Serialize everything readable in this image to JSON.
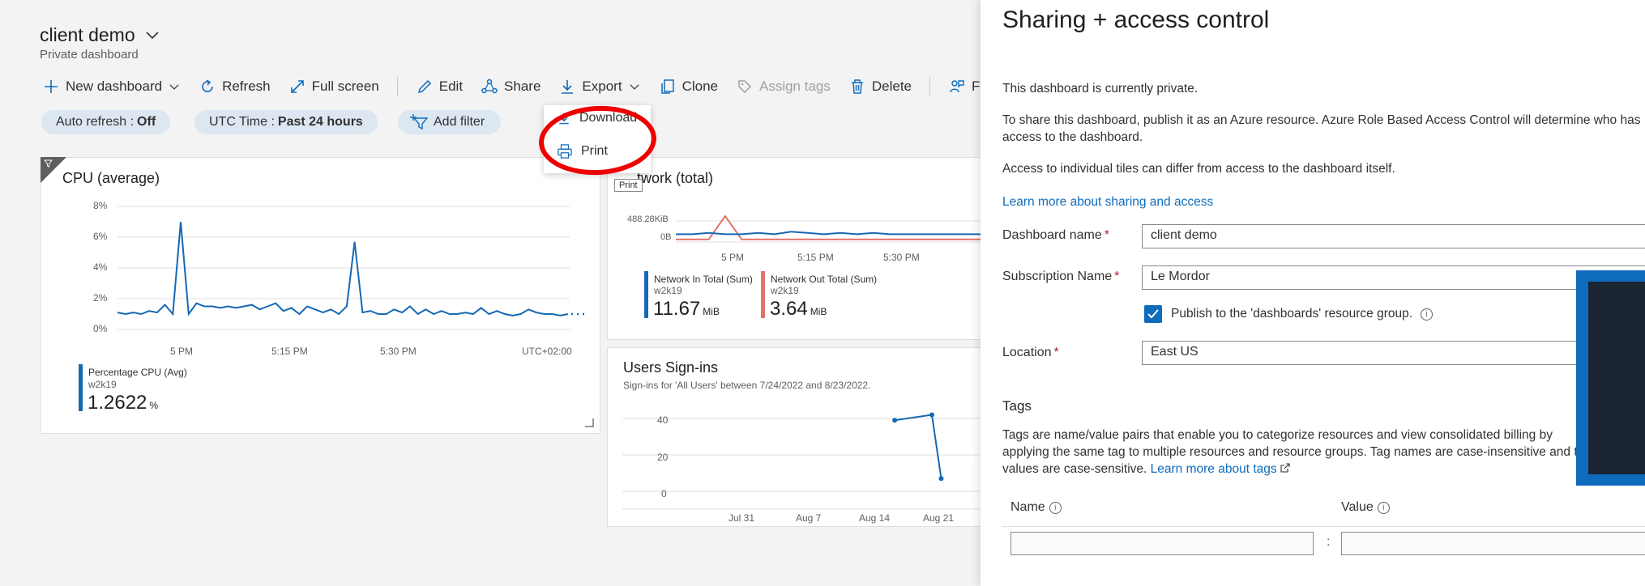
{
  "header": {
    "title": "client demo",
    "subtitle": "Private dashboard"
  },
  "toolbar": {
    "new_dashboard": "New dashboard",
    "refresh": "Refresh",
    "full_screen": "Full screen",
    "edit": "Edit",
    "share": "Share",
    "export": "Export",
    "clone": "Clone",
    "assign_tags": "Assign tags",
    "delete": "Delete",
    "feedback_partial": "Fe"
  },
  "filters": {
    "auto_refresh_label": "Auto refresh :",
    "auto_refresh_value": "Off",
    "time_label": "UTC Time :",
    "time_value": "Past 24 hours",
    "add_filter": "Add filter"
  },
  "export_menu": {
    "download": "Download",
    "print": "Print",
    "tooltip": "Print"
  },
  "cpu_tile": {
    "title": "CPU (average)",
    "y_ticks": [
      "8%",
      "6%",
      "4%",
      "2%",
      "0%"
    ],
    "x_ticks": [
      "5 PM",
      "5:15 PM",
      "5:30 PM",
      "UTC+02:00"
    ],
    "legend_name": "Percentage CPU (Avg)",
    "legend_sub": "w2k19",
    "legend_value": "1.2622",
    "legend_unit": "%"
  },
  "network_tile": {
    "title_partial": "twork (total)",
    "y_ticks": [
      "488.28KiB",
      "0B"
    ],
    "x_ticks": [
      "5 PM",
      "5:15 PM",
      "5:30 PM"
    ],
    "in_name": "Network In Total (Sum)",
    "in_sub": "w2k19",
    "in_value": "11.67",
    "in_unit": "MiB",
    "out_name": "Network Out Total (Sum)",
    "out_sub": "w2k19",
    "out_value": "3.64",
    "out_unit": "MiB"
  },
  "signins_tile": {
    "title": "Users Sign-ins",
    "subtitle": "Sign-ins for 'All Users' between 7/24/2022 and 8/23/2022.",
    "y_ticks": [
      "40",
      "20",
      "0"
    ],
    "x_ticks": [
      "Jul 31",
      "Aug 7",
      "Aug 14",
      "Aug 21"
    ]
  },
  "chart_data": [
    {
      "type": "line",
      "title": "CPU (average)",
      "ylim": [
        0,
        8
      ],
      "y_unit": "%",
      "x_ticks": [
        "5 PM",
        "5:15 PM",
        "5:30 PM"
      ],
      "series": [
        {
          "name": "Percentage CPU (Avg)",
          "values": [
            1.1,
            1.0,
            1.1,
            1.0,
            1.2,
            1.1,
            1.6,
            1.0,
            7.0,
            1.0,
            1.7,
            1.5,
            1.5,
            1.4,
            1.5,
            1.4,
            1.5,
            1.6,
            1.3,
            1.5,
            1.7,
            1.2,
            1.4,
            1.0,
            1.5,
            1.3,
            1.1,
            1.3,
            1.0,
            1.5,
            5.7,
            1.1,
            1.2,
            1.0,
            1.0,
            1.3,
            1.1,
            1.5,
            1.0,
            1.3,
            1.0,
            1.2,
            1.0,
            1.0,
            1.1,
            1.0,
            1.4,
            1.0,
            1.2,
            1.0,
            0.9,
            1.0,
            1.3,
            1.1,
            1.0,
            1.0,
            0.9,
            1.0
          ]
        }
      ]
    },
    {
      "type": "line",
      "title": "Network (total)",
      "y_ticks": [
        "488.28KiB",
        "0B"
      ],
      "x_ticks": [
        "5 PM",
        "5:15 PM",
        "5:30 PM"
      ],
      "series": [
        {
          "name": "Network In Total (Sum)",
          "values": [
            0.3,
            0.3,
            0.35,
            0.3,
            0.3,
            0.35,
            0.3,
            0.4,
            0.35,
            0.3,
            0.35,
            0.3,
            0.35,
            0.3,
            0.3,
            0.3,
            0.3,
            0.3,
            0.3,
            0.3
          ]
        },
        {
          "name": "Network Out Total (Sum)",
          "values": [
            0.1,
            0.1,
            0.1,
            1.0,
            0.1,
            0.1,
            0.1,
            0.1,
            0.1,
            0.1,
            0.1,
            0.1,
            0.1,
            0.1,
            0.1,
            0.1,
            0.1,
            0.1,
            0.1,
            0.1
          ]
        }
      ]
    },
    {
      "type": "line",
      "title": "Users Sign-ins",
      "ylim": [
        0,
        50
      ],
      "x_ticks": [
        "Jul 31",
        "Aug 7",
        "Aug 14",
        "Aug 21"
      ],
      "series": [
        {
          "name": "",
          "x": [
            "Aug 17",
            "Aug 21",
            "Aug 22"
          ],
          "values": [
            39,
            42,
            7
          ]
        }
      ]
    }
  ],
  "panel": {
    "title": "Sharing + access control",
    "private_note": "This dashboard is currently private.",
    "share_text": "To share this dashboard, publish it as an Azure resource. Azure Role Based Access Control will determine who has access to the dashboard.",
    "tiles_note": "Access to individual tiles can differ from access to the dashboard itself.",
    "learn_link": "Learn more about sharing and access",
    "dashboard_name_label": "Dashboard name",
    "dashboard_name_value": "client demo",
    "subscription_label": "Subscription Name",
    "subscription_value": "Le Mordor",
    "publish_label": "Publish to the 'dashboards' resource group.",
    "location_label": "Location",
    "location_value": "East US",
    "tags_heading": "Tags",
    "tags_text": "Tags are name/value pairs that enable you to categorize resources and view consolidated billing by applying the same tag to multiple resources and resource groups. Tag names are case-insensitive and tag values are case-sensitive.",
    "tags_link": "Learn more about tags",
    "name_col": "Name",
    "value_col": "Value"
  }
}
